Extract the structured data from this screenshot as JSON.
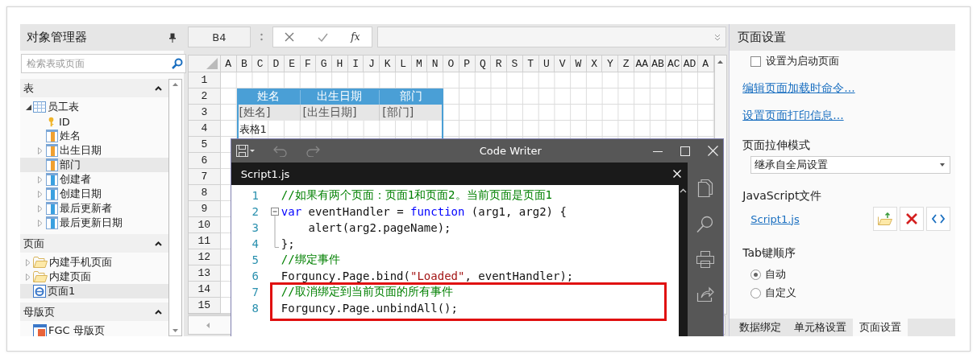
{
  "object_manager": {
    "title": "对象管理器",
    "search": {
      "placeholder": "检索表或页面"
    },
    "sections": [
      {
        "title": "表",
        "expanded": true,
        "items": [
          {
            "label": "员工表",
            "kind": "table",
            "expanded": true,
            "selected": false,
            "children": [
              {
                "label": "ID",
                "kind": "key",
                "selected": false
              },
              {
                "label": "姓名",
                "kind": "field",
                "selected": false
              },
              {
                "label": "出生日期",
                "kind": "field",
                "expanded": false,
                "selected": false
              },
              {
                "label": "部门",
                "kind": "field",
                "selected": true
              },
              {
                "label": "创建者",
                "kind": "system_field",
                "expanded": false,
                "selected": false
              },
              {
                "label": "创建日期",
                "kind": "system_field",
                "expanded": false,
                "selected": false
              },
              {
                "label": "最后更新者",
                "kind": "system_field",
                "expanded": false,
                "selected": false
              },
              {
                "label": "最后更新日期",
                "kind": "system_field",
                "expanded": false,
                "selected": false
              }
            ]
          }
        ]
      },
      {
        "title": "页面",
        "expanded": true,
        "items": [
          {
            "label": "内建手机页面",
            "kind": "folder",
            "expanded": false,
            "selected": false
          },
          {
            "label": "内建页面",
            "kind": "folder",
            "expanded": false,
            "selected": false
          },
          {
            "label": "页面1",
            "kind": "page",
            "selected": true
          }
        ]
      },
      {
        "title": "母版页",
        "expanded": true,
        "items": [
          {
            "label": "FGC 母版页",
            "kind": "master_page",
            "selected": false
          }
        ]
      }
    ]
  },
  "formula_bar": {
    "cell_ref": "B4",
    "function_label": "fx"
  },
  "sheet": {
    "columns": [
      "A",
      "B",
      "C",
      "D",
      "E",
      "F",
      "G",
      "H",
      "I",
      "J",
      "K",
      "L",
      "M",
      "N",
      "O",
      "P",
      "Q",
      "R",
      "S",
      "T",
      "U",
      "V",
      "W",
      "X",
      "Y",
      "Z",
      "AA",
      "AB",
      "AC",
      "AD",
      "A"
    ],
    "rows": [
      "1",
      "2",
      "3",
      "4",
      "5",
      "6",
      "7",
      "8",
      "9",
      "10",
      "11",
      "12",
      "13",
      "14",
      "15"
    ],
    "table": {
      "headers": [
        "姓名",
        "出生日期",
        "部门"
      ],
      "cells": [
        "[姓名]",
        "[出生日期]",
        "[部门]"
      ],
      "caption": "表格1"
    }
  },
  "code_writer": {
    "title": "Code Writer",
    "tab": "Script1.js",
    "lines": [
      {
        "number": "1",
        "kind": "plain",
        "highlighted": false,
        "tokens": [
          {
            "kind": "comment",
            "text": "//如果有两个页面：页面1和页面2。当前页面是页面1"
          }
        ]
      },
      {
        "number": "2",
        "kind": "fold_start",
        "highlighted": false,
        "tokens": [
          {
            "kind": "keyword",
            "text": "var"
          },
          {
            "kind": "plain",
            "text": " eventHandler = "
          },
          {
            "kind": "keyword",
            "text": "function"
          },
          {
            "kind": "plain",
            "text": " (arg1, arg2) {"
          }
        ]
      },
      {
        "number": "3",
        "kind": "fold_inner",
        "highlighted": false,
        "tokens": [
          {
            "kind": "plain",
            "text": "    alert(arg2.pageName);"
          }
        ]
      },
      {
        "number": "4",
        "kind": "fold_end",
        "highlighted": false,
        "tokens": [
          {
            "kind": "plain",
            "text": "};"
          }
        ]
      },
      {
        "number": "5",
        "kind": "plain",
        "highlighted": false,
        "tokens": [
          {
            "kind": "comment",
            "text": "//绑定事件"
          }
        ]
      },
      {
        "number": "6",
        "kind": "plain",
        "highlighted": false,
        "tokens": [
          {
            "kind": "plain",
            "text": "Forguncy.Page.bind("
          },
          {
            "kind": "string",
            "text": "\"Loaded\""
          },
          {
            "kind": "plain",
            "text": ", eventHandler);"
          }
        ]
      },
      {
        "number": "7",
        "kind": "plain",
        "highlighted": true,
        "tokens": [
          {
            "kind": "comment",
            "text": "//取消绑定到当前页面的所有事件"
          }
        ]
      },
      {
        "number": "8",
        "kind": "plain",
        "highlighted": true,
        "tokens": [
          {
            "kind": "plain",
            "text": "Forguncy.Page.unbindAll();"
          }
        ]
      }
    ]
  },
  "properties": {
    "title": "页面设置",
    "start_page": {
      "label": "设置为启动页面",
      "checked": false
    },
    "links": [
      "编辑页面加载时命令...",
      "设置页面打印信息..."
    ],
    "stretch_mode": {
      "label": "页面拉伸模式",
      "value": "继承自全局设置"
    },
    "javascript": {
      "label": "JavaScript文件",
      "file": "Script1.js"
    },
    "tab_order": {
      "label": "Tab键顺序",
      "options": [
        {
          "label": "自动",
          "selected": true
        },
        {
          "label": "自定义",
          "selected": false
        }
      ]
    },
    "tabs": [
      {
        "label": "数据绑定",
        "selected": false
      },
      {
        "label": "单元格设置",
        "selected": false
      },
      {
        "label": "页面设置",
        "selected": true
      }
    ]
  }
}
